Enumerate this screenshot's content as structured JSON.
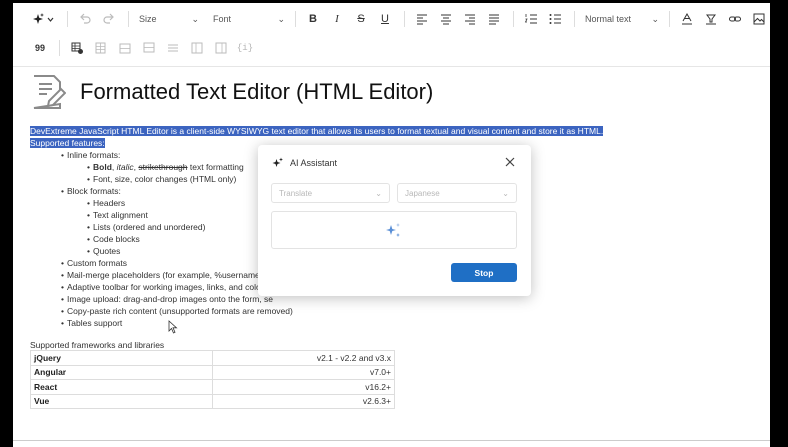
{
  "toolbar": {
    "size_label": "Size",
    "font_label": "Font",
    "heading_label": "Normal text",
    "quote_glyph": "99",
    "vars_glyph": "{i}"
  },
  "document": {
    "title": "Formatted Text Editor (HTML Editor)",
    "intro": "DevExtreme JavaScript HTML Editor is a client-side WYSIWYG text editor that allows its users to format textual and visual content and store it as HTML.",
    "features_heading": "Supported features:",
    "inline_formats": "Inline formats:",
    "bold": "Bold",
    "italic": "italic",
    "strikethrough": "strikethrough",
    "text_formatting": " text formatting",
    "font_size_color": "Font, size, color changes (HTML only)",
    "block_formats": "Block formats:",
    "headers": "Headers",
    "text_alignment": "Text alignment",
    "lists": "Lists (ordered and unordered)",
    "code_blocks": "Code blocks",
    "quotes": "Quotes",
    "custom_formats": "Custom formats",
    "mail_merge": "Mail-merge placeholders (for example, %username%)",
    "adaptive_toolbar": "Adaptive toolbar for working images, links, and color fo",
    "image_upload": "Image upload: drag-and-drop images onto the form, se",
    "copy_paste": "Copy-paste rich content (unsupported formats are removed)",
    "tables_support": "Tables support",
    "frameworks_heading": "Supported frameworks and libraries",
    "frameworks": [
      {
        "name": "jQuery",
        "version": "v2.1 - v2.2 and v3.x"
      },
      {
        "name": "Angular",
        "version": "v7.0+"
      },
      {
        "name": "React",
        "version": "v16.2+"
      },
      {
        "name": "Vue",
        "version": "v2.6.3+"
      }
    ]
  },
  "ai_dialog": {
    "title": "AI Assistant",
    "command_placeholder": "Translate",
    "language_placeholder": "Japanese",
    "stop_label": "Stop"
  }
}
